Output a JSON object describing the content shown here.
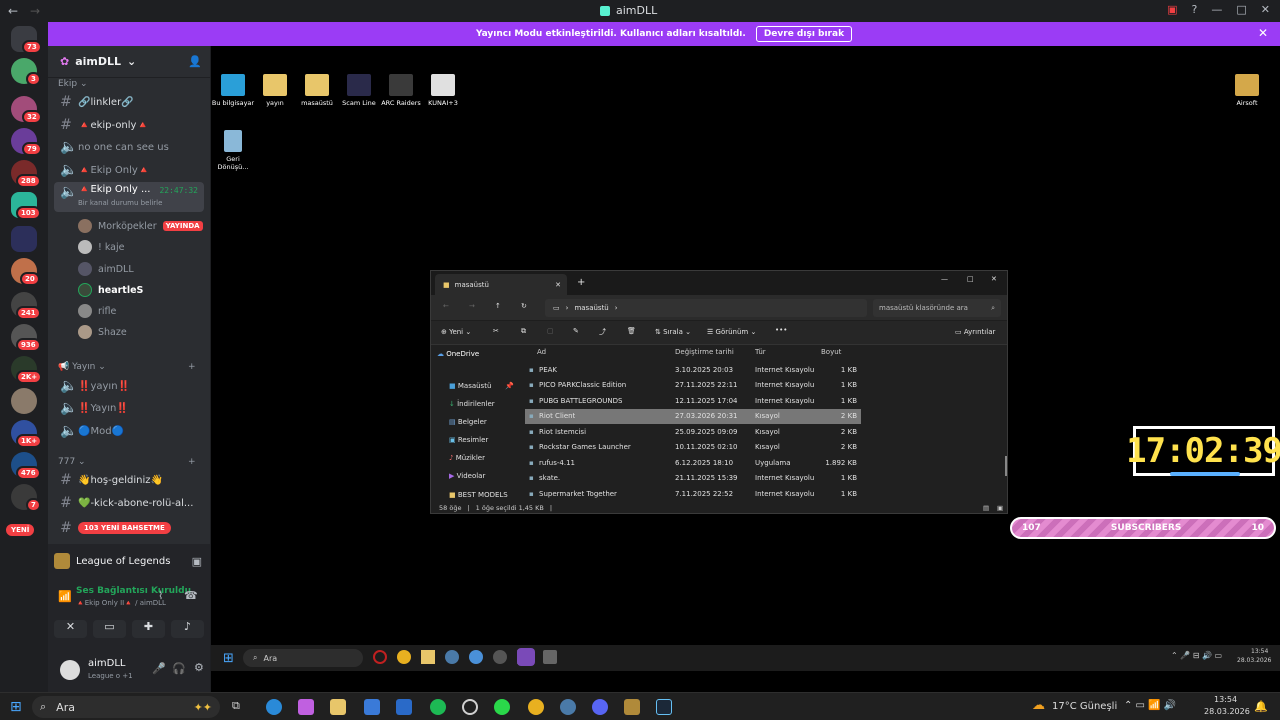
{
  "window": {
    "title": "aimDLL"
  },
  "banner": {
    "text": "Yayıncı Modu etkinleştirildi. Kullanıcı adları kısaltıldı.",
    "button": "Devre dışı bırak"
  },
  "rail": {
    "badges": [
      "73",
      "3",
      "32",
      "79",
      "288",
      "103",
      "20",
      "241",
      "936",
      "2K+",
      "1K+",
      "476",
      "7"
    ],
    "new_label": "YENİ"
  },
  "server": {
    "name": "aimDLL"
  },
  "categories": {
    "ekip": "Ekip",
    "yayin": "Yayın",
    "c777": "777"
  },
  "channels": [
    {
      "label": "🔗linkler🔗"
    },
    {
      "label": "🔺ekip-only🔺"
    },
    {
      "label": "no one can see us"
    },
    {
      "label": "🔺Ekip Only🔺"
    },
    {
      "label": "🔺Ekip Only ...",
      "time": "22:47:32",
      "sub": "Bir kanal durumu belirle"
    },
    {
      "label": "‼️yayın‼️"
    },
    {
      "label": "‼️Yayın‼️"
    },
    {
      "label": "🔵Mod🔵"
    },
    {
      "label": "👋hoş-geldiniz👋"
    },
    {
      "label": "💚-kick-abone-rolü-al..."
    }
  ],
  "voice_users": [
    {
      "name": "Morköpekler",
      "live": "YAYINDA"
    },
    {
      "name": "! kaje"
    },
    {
      "name": "aimDLL"
    },
    {
      "name": "heartleS"
    },
    {
      "name": "rifle"
    },
    {
      "name": "Shaze"
    }
  ],
  "new_pill": "103 YENİ BAHSETME",
  "activity": {
    "game": "League of Legends"
  },
  "voice_status": {
    "title": "Ses Bağlantısı Kuruldu",
    "sub": "🔺Ekip Only II🔺 / aimDLL"
  },
  "user_panel": {
    "name": "aimDLL",
    "status": "League o +1"
  },
  "desktop_icons": [
    "Bu bilgisayar",
    "yayın",
    "masaüstü",
    "Scam Line",
    "ARC Raiders",
    "KUNAI+3",
    "Airsoft",
    "Geri Dönüşü..."
  ],
  "explorer": {
    "tab": "masaüstü",
    "breadcrumb": "masaüstü",
    "search_placeholder": "masaüstü klasöründe ara",
    "cmd": {
      "new": "Yeni",
      "sort": "Sırala",
      "view": "Görünüm",
      "details": "Ayrıntılar"
    },
    "columns": [
      "Ad",
      "Değiştirme tarihi",
      "Tür",
      "Boyut"
    ],
    "nav": [
      "OneDrive",
      "Masaüstü",
      "İndirilenler",
      "Belgeler",
      "Resimler",
      "Müzikler",
      "Videolar",
      "BEST MODELS"
    ],
    "rows": [
      [
        "PEAK",
        "3.10.2025 20:03",
        "Internet Kısayolu",
        "1 KB"
      ],
      [
        "PICO PARKClassic Edition",
        "27.11.2025 22:11",
        "Internet Kısayolu",
        "1 KB"
      ],
      [
        "PUBG BATTLEGROUNDS",
        "12.11.2025 17:04",
        "Internet Kısayolu",
        "1 KB"
      ],
      [
        "Riot Client",
        "27.03.2026 20:31",
        "Kısayol",
        "2 KB"
      ],
      [
        "Riot İstemcisi",
        "25.09.2025 09:09",
        "Kısayol",
        "2 KB"
      ],
      [
        "Rockstar Games Launcher",
        "10.11.2025 02:10",
        "Kısayol",
        "2 KB"
      ],
      [
        "rufus-4.11",
        "6.12.2025 18:10",
        "Uygulama",
        "1.892 KB"
      ],
      [
        "skate.",
        "21.11.2025 15:39",
        "Internet Kısayolu",
        "1 KB"
      ],
      [
        "Supermarket Together",
        "7.11.2025 22:52",
        "Internet Kısayolu",
        "1 KB"
      ]
    ],
    "status": {
      "count": "58 öğe",
      "selected": "1 öğe seçildi 1,45 KB"
    }
  },
  "clock": "17:02:39",
  "subs": {
    "left": "107",
    "label": "SUBSCRIBERS",
    "right": "10"
  },
  "inner_taskbar": {
    "search": "Ara",
    "time": "13:54",
    "date": "28.03.2026"
  },
  "outer_taskbar": {
    "search": "Ara",
    "weather": "17°C Güneşli",
    "time": "13:54",
    "date": "28.03.2026"
  }
}
